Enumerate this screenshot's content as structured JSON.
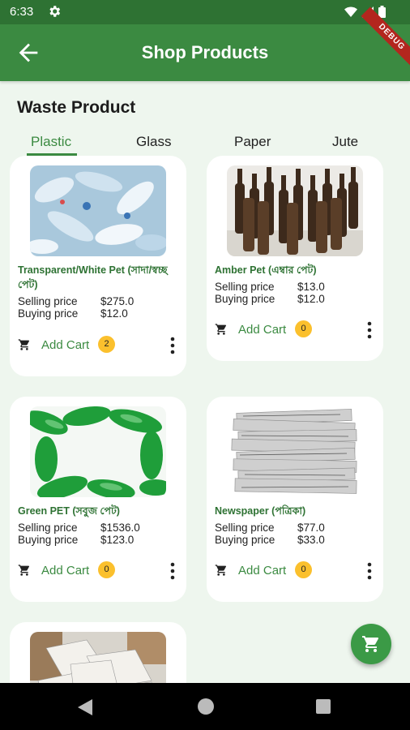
{
  "status_bar": {
    "time": "6:33"
  },
  "app_bar": {
    "title": "Shop Products",
    "debug_label": "DEBUG"
  },
  "section_title": "Waste Product",
  "tabs": [
    {
      "label": "Plastic",
      "active": true
    },
    {
      "label": "Glass",
      "active": false
    },
    {
      "label": "Paper",
      "active": false
    },
    {
      "label": "Jute",
      "active": false
    }
  ],
  "labels": {
    "selling": "Selling price",
    "buying": "Buying price",
    "add_cart": "Add Cart"
  },
  "products": [
    {
      "name": "Transparent/White Pet (সাদা/স্বচ্ছ পেট)",
      "selling_price": "$275.0",
      "buying_price": "$12.0",
      "cart_count": "2"
    },
    {
      "name": "Amber Pet (এম্বার পেট)",
      "selling_price": "$13.0",
      "buying_price": "$12.0",
      "cart_count": "0"
    },
    {
      "name": "Green PET (সবুজ পেট)",
      "selling_price": "$1536.0",
      "buying_price": "$123.0",
      "cart_count": "0"
    },
    {
      "name": "Newspaper (পত্রিকা)",
      "selling_price": "$77.0",
      "buying_price": "$33.0",
      "cart_count": "0"
    }
  ],
  "colors": {
    "primary": "#3b8a41",
    "status_bar": "#2e7233",
    "badge": "#fbc02d",
    "background": "#eef6ee"
  }
}
